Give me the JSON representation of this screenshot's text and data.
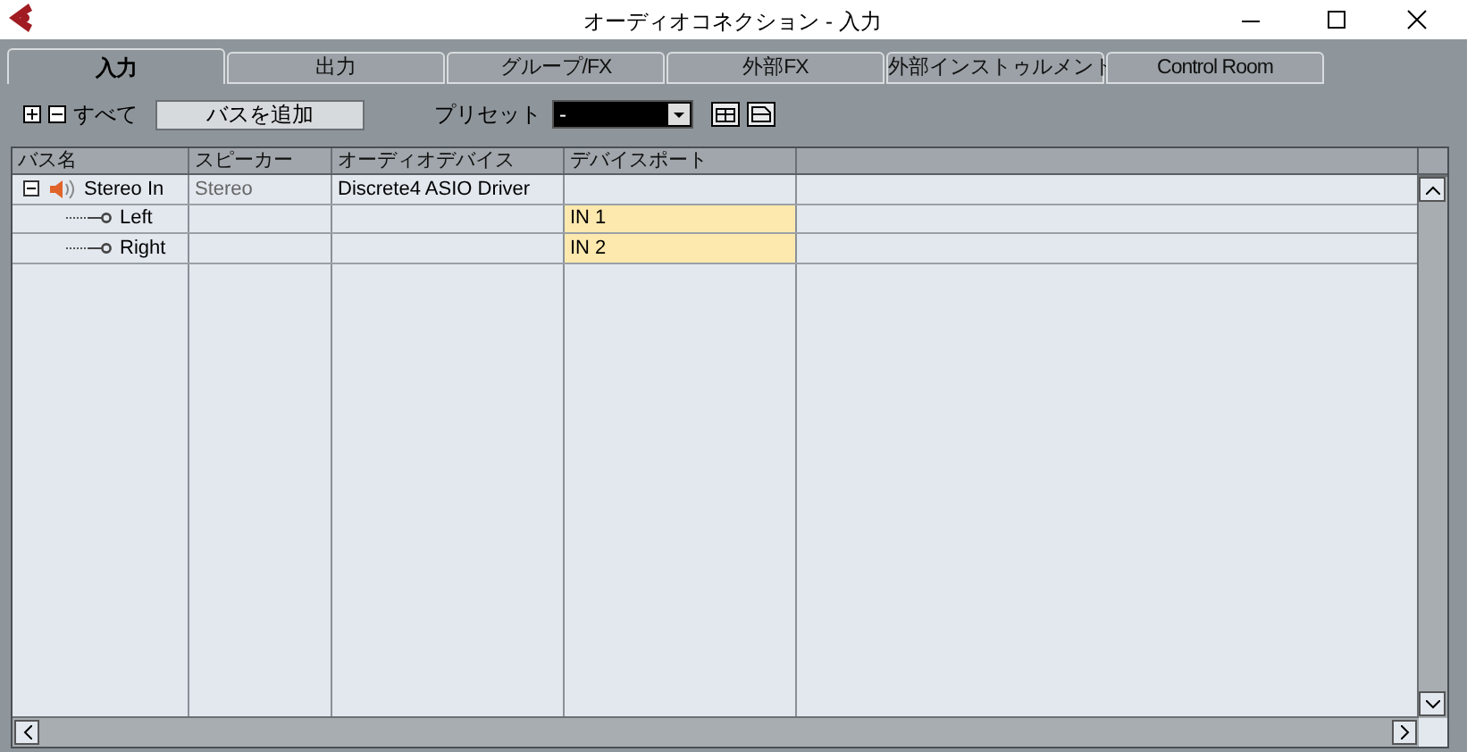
{
  "window": {
    "title": "オーディオコネクション - 入力"
  },
  "tabs": [
    {
      "label": "入力",
      "selected": true
    },
    {
      "label": "出力",
      "selected": false
    },
    {
      "label": "グループ/FX",
      "selected": false
    },
    {
      "label": "外部FX",
      "selected": false
    },
    {
      "label": "外部インストゥルメント",
      "selected": false
    },
    {
      "label": "Control Room",
      "selected": false
    }
  ],
  "toolbar": {
    "all_label": "すべて",
    "add_bus_button": "バスを追加",
    "preset_label": "プリセット",
    "preset_value": "-"
  },
  "table": {
    "columns": [
      "バス名",
      "スピーカー",
      "オーディオデバイス",
      "デバイスポート"
    ],
    "rows": [
      {
        "name": "Stereo In",
        "speaker": "Stereo",
        "device": "Discrete4 ASIO Driver",
        "expanded": true,
        "children": [
          {
            "name": "Left",
            "port": "IN 1",
            "port_highlighted": true
          },
          {
            "name": "Right",
            "port": "IN 2",
            "port_highlighted": true
          }
        ]
      }
    ]
  }
}
